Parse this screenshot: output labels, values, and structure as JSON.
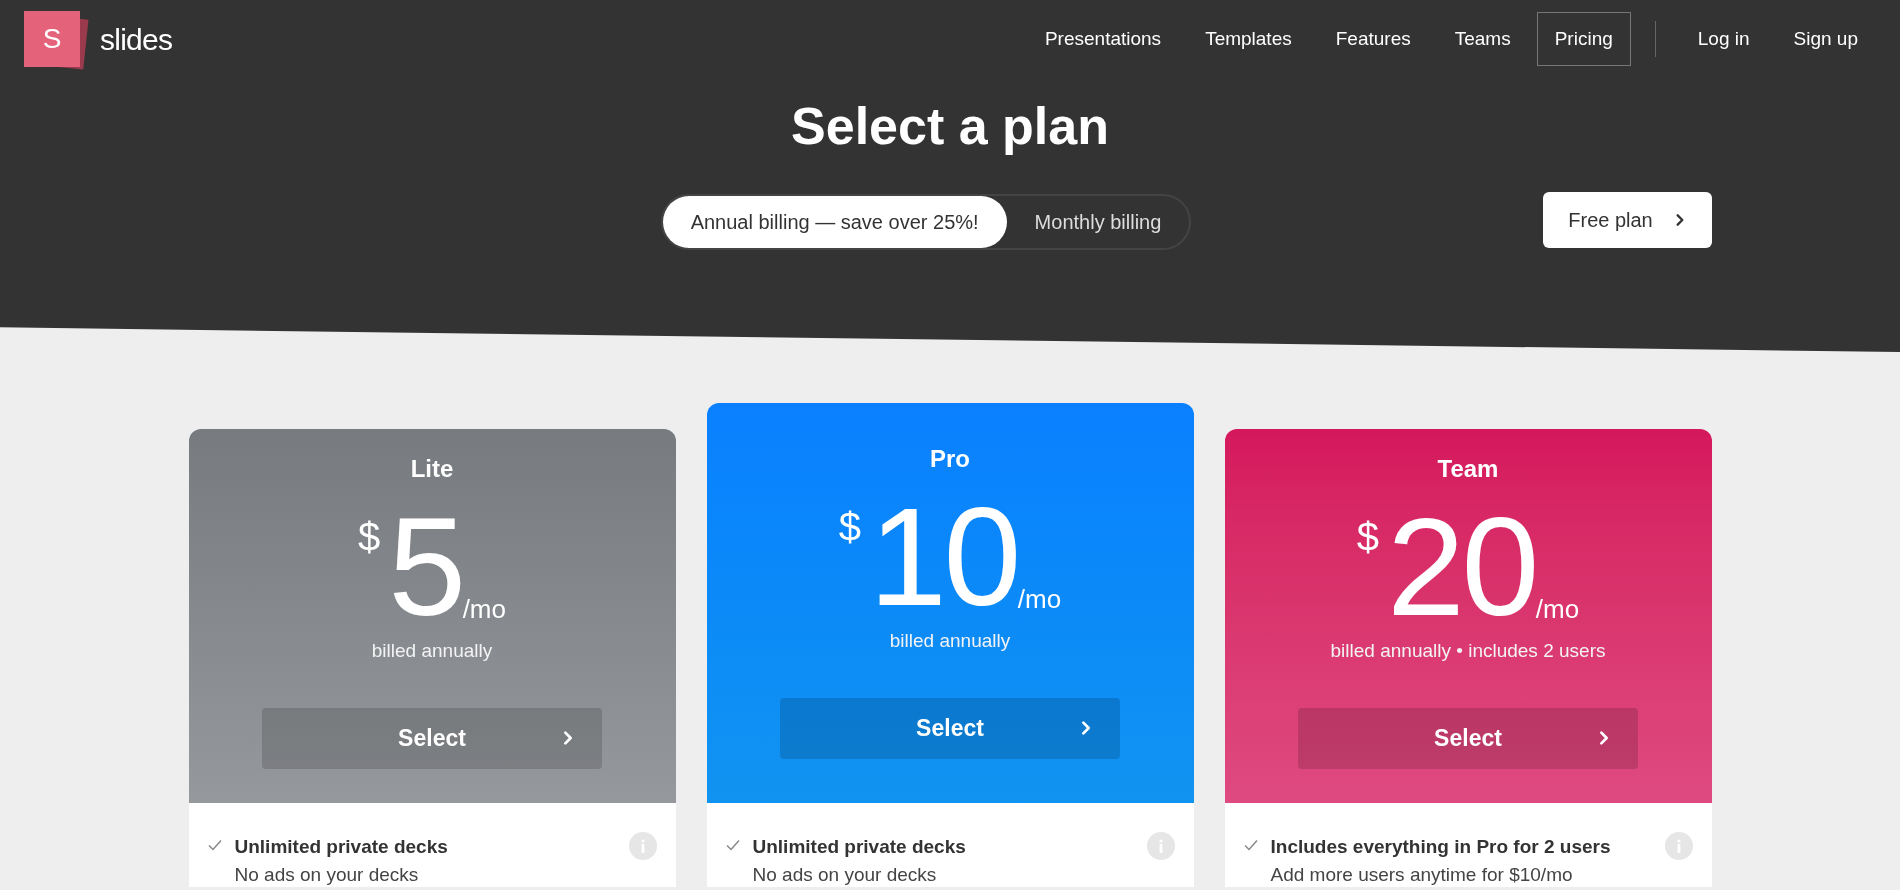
{
  "brand": {
    "logo_letter": "S",
    "name": "slides"
  },
  "nav": [
    {
      "label": "Presentations",
      "selected": false
    },
    {
      "label": "Templates",
      "selected": false
    },
    {
      "label": "Features",
      "selected": false
    },
    {
      "label": "Teams",
      "selected": false
    },
    {
      "label": "Pricing",
      "selected": true
    }
  ],
  "account_links": [
    "Log in",
    "Sign up"
  ],
  "title": "Select a plan",
  "billing": [
    {
      "label": "Annual billing — save over 25%!",
      "selected": true
    },
    {
      "label": "Monthly billing",
      "selected": false
    }
  ],
  "free_plan": "Free plan",
  "plans": [
    {
      "name": "Lite",
      "currency": "$",
      "price": "5",
      "period": "/mo",
      "note": "billed annually",
      "button": "Select",
      "color": "#777b80",
      "featured": false,
      "features": [
        {
          "title": "Unlimited private decks",
          "detail": "No ads on your decks"
        }
      ]
    },
    {
      "name": "Pro",
      "currency": "$",
      "price": "10",
      "period": "/mo",
      "note": "billed annually",
      "button": "Select",
      "color": "#0a80ff",
      "featured": true,
      "features": [
        {
          "title": "Unlimited private decks",
          "detail": "No ads on your decks"
        }
      ]
    },
    {
      "name": "Team",
      "currency": "$",
      "price": "20",
      "period": "/mo",
      "note": "billed annually • includes 2 users",
      "button": "Select",
      "color": "#d5175c",
      "featured": false,
      "features": [
        {
          "title": "Includes everything in Pro for 2 users",
          "detail": "Add more users anytime for $10/mo"
        }
      ]
    }
  ]
}
